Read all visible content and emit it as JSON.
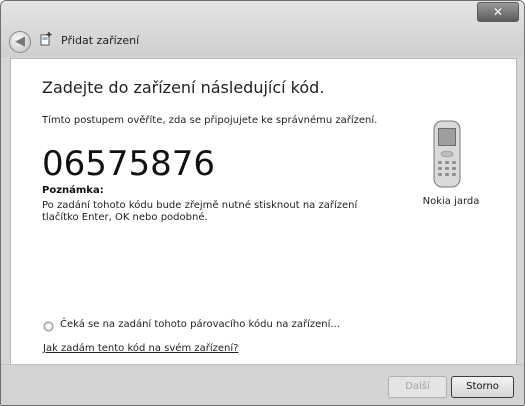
{
  "window": {
    "close_label": "✕",
    "title": "Přidat zařízení"
  },
  "main": {
    "heading": "Zadejte do zařízení následující kód.",
    "description": "Tímto postupem ověříte, zda se připojujete ke správnému zařízení.",
    "pin_code": "06575876",
    "note_label": "Poznámka:",
    "note_text": "Po zadání tohoto kódu bude zřejmě nutné stisknout na zařízení tlačítko Enter, OK nebo podobné.",
    "device_name": "Nokia jarda",
    "waiting_status": "Čeká se na zadání tohoto párovacího kódu na zařízení...",
    "help_link": "Jak zadám tento kód na svém zařízení?"
  },
  "footer": {
    "next_label": "Další",
    "cancel_label": "Storno"
  },
  "icons": {
    "back": "back-arrow-icon",
    "wizard": "add-device-icon",
    "device": "mobile-phone-icon",
    "spinner": "busy-spinner-icon"
  }
}
